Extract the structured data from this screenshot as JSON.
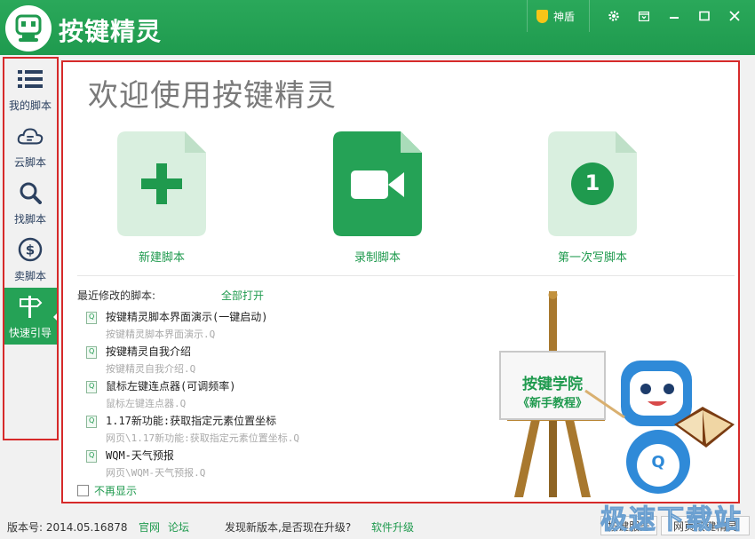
{
  "header": {
    "title": "按键精灵",
    "shield_label": "神盾",
    "icons": [
      "gear-icon",
      "menu-icon",
      "minimize-icon",
      "maximize-icon",
      "close-icon"
    ]
  },
  "sidebar": {
    "items": [
      {
        "label": "我的脚本",
        "icon": "list-icon"
      },
      {
        "label": "云脚本",
        "icon": "cloud-icon"
      },
      {
        "label": "找脚本",
        "icon": "search-icon"
      },
      {
        "label": "卖脚本",
        "icon": "dollar-icon"
      },
      {
        "label": "快速引导",
        "icon": "signpost-icon",
        "active": true
      }
    ]
  },
  "main": {
    "welcome": "欢迎使用按键精灵",
    "tiles": [
      {
        "label": "新建脚本",
        "icon": "plus-icon"
      },
      {
        "label": "录制脚本",
        "icon": "video-camera-icon"
      },
      {
        "label": "第一次写脚本",
        "icon": "number-one-icon",
        "number": "1"
      }
    ],
    "recent_heading": "最近修改的脚本:",
    "open_all": "全部打开",
    "recent": [
      {
        "title": "按键精灵脚本界面演示(一键启动)",
        "path": "按键精灵脚本界面演示.Q"
      },
      {
        "title": "按键精灵自我介绍",
        "path": "按键精灵自我介绍.Q"
      },
      {
        "title": "鼠标左键连点器(可调频率)",
        "path": "鼠标左键连点器.Q"
      },
      {
        "title": "1.17新功能:获取指定元素位置坐标",
        "path": "网页\\1.17新功能:获取指定元素位置坐标.Q"
      },
      {
        "title": "WQM-天气预报",
        "path": "网页\\WQM-天气预报.Q"
      }
    ],
    "no_show": "不再显示",
    "easel": {
      "line1": "按键学院",
      "line2": "《新手教程》",
      "mascot_letter": "Q"
    }
  },
  "footer": {
    "version": "版本号: 2014.05.16878",
    "official": "官网",
    "forum": "论坛",
    "update_msg": "发现新版本,是否现在升级?",
    "update_link": "软件升级",
    "btn1": "按键服务",
    "btn2": "网页按键精灵",
    "watermark": "极速下载站"
  },
  "colors": {
    "brand_green": "#1f9a4e",
    "annotation_red": "#d62a2a",
    "shield_gold": "#f5c518"
  }
}
